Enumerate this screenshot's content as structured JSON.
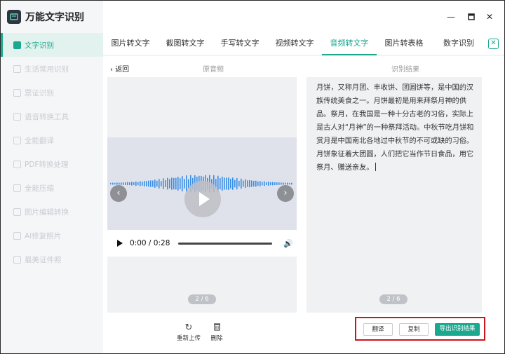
{
  "app": {
    "title": "万能文字识别"
  },
  "sidebar": {
    "items": [
      {
        "label": "文字识别"
      },
      {
        "label": "生活常用识别"
      },
      {
        "label": "票证识别"
      },
      {
        "label": "语音转换工具"
      },
      {
        "label": "全能翻译"
      },
      {
        "label": "PDF转换处理"
      },
      {
        "label": "全能压缩"
      },
      {
        "label": "图片编辑转换"
      },
      {
        "label": "AI修复照片"
      },
      {
        "label": "最美证件照"
      }
    ]
  },
  "tabs": [
    {
      "label": "图片转文字"
    },
    {
      "label": "截图转文字"
    },
    {
      "label": "手写转文字"
    },
    {
      "label": "视频转文字"
    },
    {
      "label": "音频转文字"
    },
    {
      "label": "图片转表格"
    },
    {
      "label": "数字识别"
    }
  ],
  "content": {
    "back_label": "返回",
    "original_header": "原音频",
    "result_header": "识别结果",
    "audio_time": "0:00 / 0:28",
    "left_page": "2 / 6",
    "right_page": "2 / 6",
    "result_text": "月饼，又称月团、丰收饼、团圆饼等，是中国的汉族传统美食之一。月饼最初是用来拜祭月神的供品。祭月，在我国是一种十分古老的习俗，实际上是古人对“月神”的一种祭拜活动。中秋节吃月饼和赏月是中国南北各地过中秋节的不可或缺的习俗。月饼象征着大团圆，人们把它当作节日食品，用它祭月、赠送亲友。"
  },
  "toolbar": {
    "reupload_label": "重新上传",
    "delete_label": "删除",
    "translate_label": "翻译",
    "copy_label": "复制",
    "export_label": "导出识别结果"
  },
  "colors": {
    "accent": "#1aa88e",
    "highlight_border": "#c8171e"
  }
}
